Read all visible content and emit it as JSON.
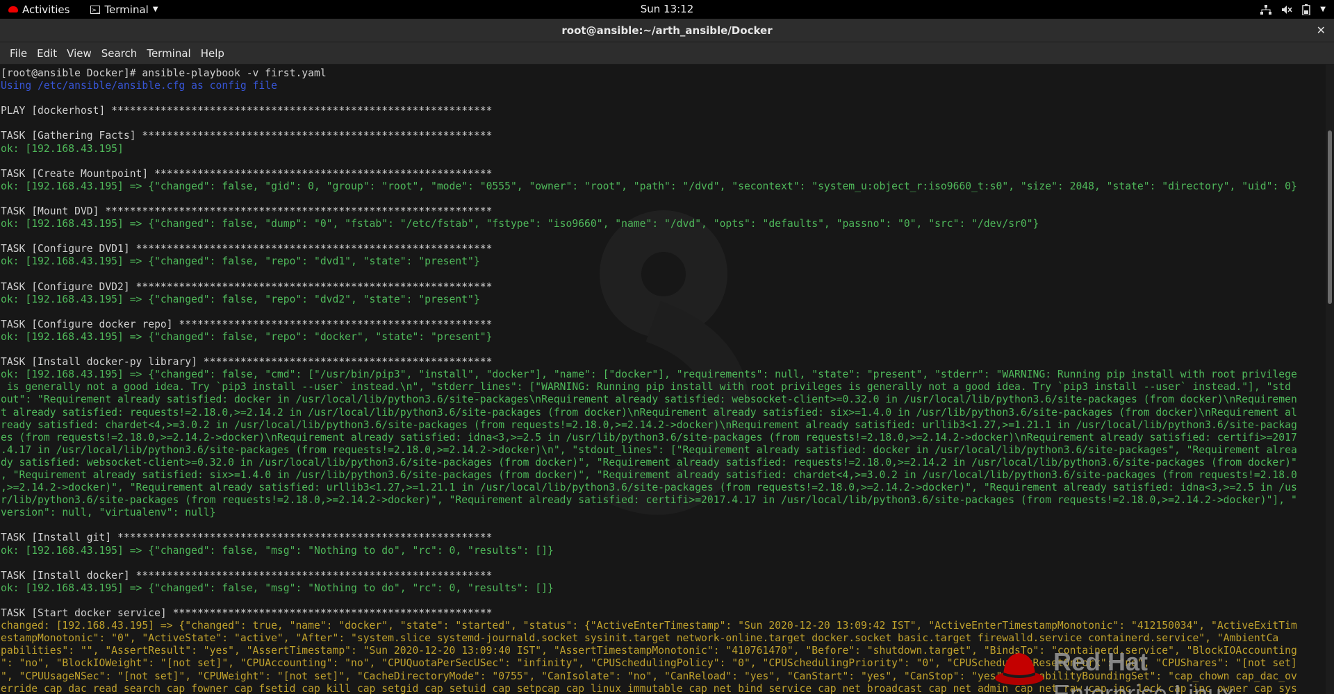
{
  "topbar": {
    "activities": "Activities",
    "app_menu": "Terminal",
    "clock": "Sun 13:12",
    "indicators": [
      "network-icon",
      "volume-muted-icon",
      "battery-icon",
      "chevron-down-icon"
    ]
  },
  "window": {
    "title": "root@ansible:~/arth_ansible/Docker",
    "close": "✕"
  },
  "menubar": {
    "items": [
      "File",
      "Edit",
      "View",
      "Search",
      "Terminal",
      "Help"
    ]
  },
  "colors": {
    "ok": "#4fb85a",
    "changed": "#c0a22d",
    "info": "#3755d6",
    "text": "#d0d0d0",
    "background": "#171717"
  },
  "watermark": {
    "brand_line1": "Red Hat",
    "brand_line2": "Enterprise Linux",
    "release_glyph": "8"
  },
  "terminal": {
    "lines": [
      {
        "c": "w",
        "t": "[root@ansible Docker]# ansible-playbook -v first.yaml"
      },
      {
        "c": "b",
        "t": "Using /etc/ansible/ansible.cfg as config file"
      },
      {
        "c": "w",
        "t": ""
      },
      {
        "c": "w",
        "t": "PLAY [dockerhost] **************************************************************"
      },
      {
        "c": "w",
        "t": ""
      },
      {
        "c": "w",
        "t": "TASK [Gathering Facts] *********************************************************"
      },
      {
        "c": "g",
        "t": "ok: [192.168.43.195]"
      },
      {
        "c": "w",
        "t": ""
      },
      {
        "c": "w",
        "t": "TASK [Create Mountpoint] *******************************************************"
      },
      {
        "c": "g",
        "t": "ok: [192.168.43.195] => {\"changed\": false, \"gid\": 0, \"group\": \"root\", \"mode\": \"0555\", \"owner\": \"root\", \"path\": \"/dvd\", \"secontext\": \"system_u:object_r:iso9660_t:s0\", \"size\": 2048, \"state\": \"directory\", \"uid\": 0}"
      },
      {
        "c": "w",
        "t": ""
      },
      {
        "c": "w",
        "t": "TASK [Mount DVD] ***************************************************************"
      },
      {
        "c": "g",
        "t": "ok: [192.168.43.195] => {\"changed\": false, \"dump\": \"0\", \"fstab\": \"/etc/fstab\", \"fstype\": \"iso9660\", \"name\": \"/dvd\", \"opts\": \"defaults\", \"passno\": \"0\", \"src\": \"/dev/sr0\"}"
      },
      {
        "c": "w",
        "t": ""
      },
      {
        "c": "w",
        "t": "TASK [Configure DVD1] **********************************************************"
      },
      {
        "c": "g",
        "t": "ok: [192.168.43.195] => {\"changed\": false, \"repo\": \"dvd1\", \"state\": \"present\"}"
      },
      {
        "c": "w",
        "t": ""
      },
      {
        "c": "w",
        "t": "TASK [Configure DVD2] **********************************************************"
      },
      {
        "c": "g",
        "t": "ok: [192.168.43.195] => {\"changed\": false, \"repo\": \"dvd2\", \"state\": \"present\"}"
      },
      {
        "c": "w",
        "t": ""
      },
      {
        "c": "w",
        "t": "TASK [Configure docker repo] ***************************************************"
      },
      {
        "c": "g",
        "t": "ok: [192.168.43.195] => {\"changed\": false, \"repo\": \"docker\", \"state\": \"present\"}"
      },
      {
        "c": "w",
        "t": ""
      },
      {
        "c": "w",
        "t": "TASK [Install docker-py library] ***********************************************"
      },
      {
        "c": "g",
        "t": "ok: [192.168.43.195] => {\"changed\": false, \"cmd\": [\"/usr/bin/pip3\", \"install\", \"docker\"], \"name\": [\"docker\"], \"requirements\": null, \"state\": \"present\", \"stderr\": \"WARNING: Running pip install with root privilege"
      },
      {
        "c": "g",
        "t": " is generally not a good idea. Try `pip3 install --user` instead.\\n\", \"stderr_lines\": [\"WARNING: Running pip install with root privileges is generally not a good idea. Try `pip3 install --user` instead.\"], \"std"
      },
      {
        "c": "g",
        "t": "out\": \"Requirement already satisfied: docker in /usr/local/lib/python3.6/site-packages\\nRequirement already satisfied: websocket-client>=0.32.0 in /usr/local/lib/python3.6/site-packages (from docker)\\nRequiremen"
      },
      {
        "c": "g",
        "t": "t already satisfied: requests!=2.18.0,>=2.14.2 in /usr/local/lib/python3.6/site-packages (from docker)\\nRequirement already satisfied: six>=1.4.0 in /usr/lib/python3.6/site-packages (from docker)\\nRequirement al"
      },
      {
        "c": "g",
        "t": "ready satisfied: chardet<4,>=3.0.2 in /usr/local/lib/python3.6/site-packages (from requests!=2.18.0,>=2.14.2->docker)\\nRequirement already satisfied: urllib3<1.27,>=1.21.1 in /usr/local/lib/python3.6/site-packag"
      },
      {
        "c": "g",
        "t": "es (from requests!=2.18.0,>=2.14.2->docker)\\nRequirement already satisfied: idna<3,>=2.5 in /usr/lib/python3.6/site-packages (from requests!=2.18.0,>=2.14.2->docker)\\nRequirement already satisfied: certifi>=2017"
      },
      {
        "c": "g",
        "t": ".4.17 in /usr/local/lib/python3.6/site-packages (from requests!=2.18.0,>=2.14.2->docker)\\n\", \"stdout_lines\": [\"Requirement already satisfied: docker in /usr/local/lib/python3.6/site-packages\", \"Requirement alrea"
      },
      {
        "c": "g",
        "t": "dy satisfied: websocket-client>=0.32.0 in /usr/local/lib/python3.6/site-packages (from docker)\", \"Requirement already satisfied: requests!=2.18.0,>=2.14.2 in /usr/local/lib/python3.6/site-packages (from docker)\""
      },
      {
        "c": "g",
        "t": ", \"Requirement already satisfied: six>=1.4.0 in /usr/lib/python3.6/site-packages (from docker)\", \"Requirement already satisfied: chardet<4,>=3.0.2 in /usr/local/lib/python3.6/site-packages (from requests!=2.18.0"
      },
      {
        "c": "g",
        "t": ",>=2.14.2->docker)\", \"Requirement already satisfied: urllib3<1.27,>=1.21.1 in /usr/local/lib/python3.6/site-packages (from requests!=2.18.0,>=2.14.2->docker)\", \"Requirement already satisfied: idna<3,>=2.5 in /us"
      },
      {
        "c": "g",
        "t": "r/lib/python3.6/site-packages (from requests!=2.18.0,>=2.14.2->docker)\", \"Requirement already satisfied: certifi>=2017.4.17 in /usr/local/lib/python3.6/site-packages (from requests!=2.18.0,>=2.14.2->docker)\"], \""
      },
      {
        "c": "g",
        "t": "version\": null, \"virtualenv\": null}"
      },
      {
        "c": "w",
        "t": ""
      },
      {
        "c": "w",
        "t": "TASK [Install git] *************************************************************"
      },
      {
        "c": "g",
        "t": "ok: [192.168.43.195] => {\"changed\": false, \"msg\": \"Nothing to do\", \"rc\": 0, \"results\": []}"
      },
      {
        "c": "w",
        "t": ""
      },
      {
        "c": "w",
        "t": "TASK [Install docker] **********************************************************"
      },
      {
        "c": "g",
        "t": "ok: [192.168.43.195] => {\"changed\": false, \"msg\": \"Nothing to do\", \"rc\": 0, \"results\": []}"
      },
      {
        "c": "w",
        "t": ""
      },
      {
        "c": "w",
        "t": "TASK [Start docker service] ****************************************************"
      },
      {
        "c": "y",
        "t": "changed: [192.168.43.195] => {\"changed\": true, \"name\": \"docker\", \"state\": \"started\", \"status\": {\"ActiveEnterTimestamp\": \"Sun 2020-12-20 13:09:42 IST\", \"ActiveEnterTimestampMonotonic\": \"412150034\", \"ActiveExitTim"
      },
      {
        "c": "y",
        "t": "estampMonotonic\": \"0\", \"ActiveState\": \"active\", \"After\": \"system.slice systemd-journald.socket sysinit.target network-online.target docker.socket basic.target firewalld.service containerd.service\", \"AmbientCa"
      },
      {
        "c": "y",
        "t": "pabilities\": \"\", \"AssertResult\": \"yes\", \"AssertTimestamp\": \"Sun 2020-12-20 13:09:40 IST\", \"AssertTimestampMonotonic\": \"410761470\", \"Before\": \"shutdown.target\", \"BindsTo\": \"containerd.service\", \"BlockIOAccounting"
      },
      {
        "c": "y",
        "t": "\": \"no\", \"BlockIOWeight\": \"[not set]\", \"CPUAccounting\": \"no\", \"CPUQuotaPerSecUSec\": \"infinity\", \"CPUSchedulingPolicy\": \"0\", \"CPUSchedulingPriority\": \"0\", \"CPUSchedulingResetOnFork\": \"no\", \"CPUShares\": \"[not set]"
      },
      {
        "c": "y",
        "t": "\", \"CPUUsageNSec\": \"[not set]\", \"CPUWeight\": \"[not set]\", \"CacheDirectoryMode\": \"0755\", \"CanIsolate\": \"no\", \"CanReload\": \"yes\", \"CanStart\": \"yes\", \"CanStop\": \"yes\", \"CapabilityBoundingSet\": \"cap_chown cap_dac_ov"
      },
      {
        "c": "y",
        "t": "erride cap_dac_read_search cap_fowner cap_fsetid cap_kill cap_setgid cap_setuid cap_setpcap cap_linux_immutable cap_net_bind_service cap_net_broadcast cap_net_admin cap_net_raw cap_ipc_lock cap_ipc_owner cap_sys"
      }
    ]
  }
}
